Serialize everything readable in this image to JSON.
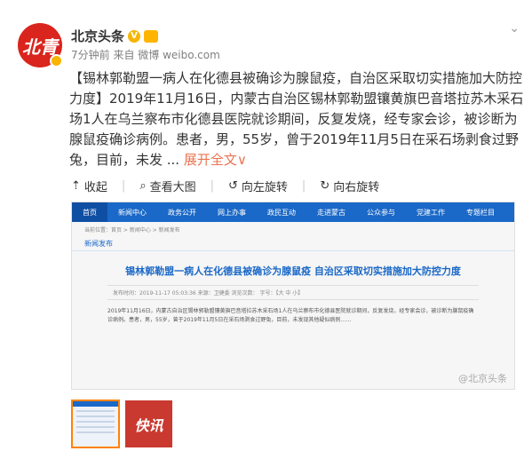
{
  "account": {
    "name": "北京头条",
    "avatar_text": "北青",
    "meta": "7分钟前 来自 微博 weibo.com"
  },
  "post": {
    "text": "【锡林郭勒盟一病人在化德县被确诊为腺鼠疫，自治区采取切实措施加大防控力度】2019年11月16日，内蒙古自治区锡林郭勒盟镶黄旗巴音塔拉苏木采石场1人在乌兰察布市化德县医院就诊期间，反复发烧，经专家会诊，被诊断为腺鼠疫确诊病例。患者，男，55岁，曾于2019年11月5日在采石场剥食过野兔，目前，未发 ...",
    "expand": "展开全文",
    "expand_caret": "∨"
  },
  "actions": {
    "collapse": "收起",
    "view_large": "查看大图",
    "rotate_left": "向左旋转",
    "rotate_right": "向右旋转"
  },
  "preview": {
    "nav": [
      "首页",
      "新闻中心",
      "政务公开",
      "网上办事",
      "政民互动",
      "走进蒙古",
      "公众参与",
      "党建工作",
      "专题栏目"
    ],
    "breadcrumb": "当前位置：首页 > 新闻中心 > 新闻发布",
    "section": "新闻发布",
    "title": "锡林郭勒盟一病人在化德县被确诊为腺鼠疫 自治区采取切实措施加大防控力度",
    "metaline": "发布时间：2019-11-17 05:03:36   来源：卫健委   浏览次数：   字号：【大 中 小】",
    "body": "2019年11月16日，内蒙古自治区锡林郭勒盟镶黄旗巴音塔拉苏木采石场1人在乌兰察布市化德县医院就诊期间，反复发烧，经专家会诊，被诊断为腺鼠疫确诊病例。患者，男，55岁，曾于2019年11月5日在采石场剥食过野兔，目前，未发现其他疑似病例……",
    "watermark": "@北京头条"
  },
  "thumb2_text": "快讯"
}
